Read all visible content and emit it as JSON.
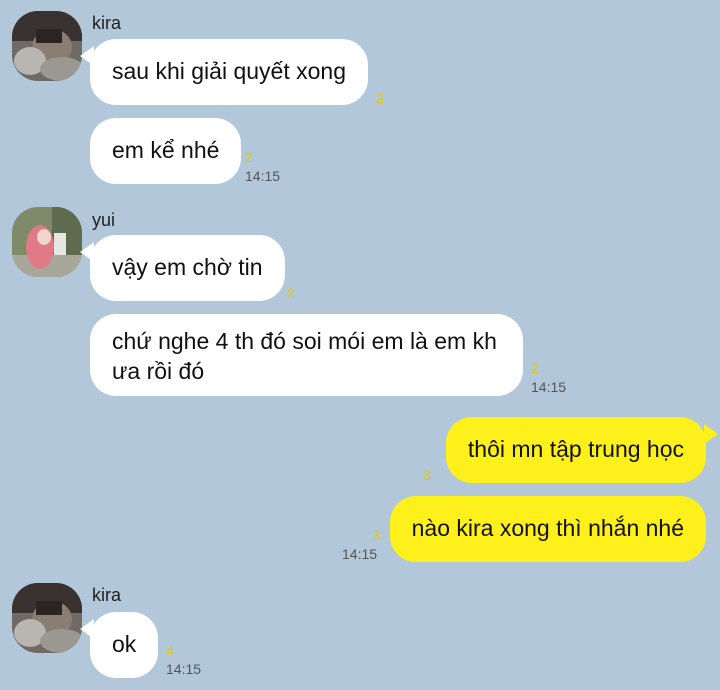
{
  "messages": [
    {
      "sender": "kira",
      "text": "sau khi giải quyết xong",
      "unread": "2"
    },
    {
      "sender": "kira",
      "text": "em kể nhé",
      "unread": "2",
      "time": "14:15"
    },
    {
      "sender": "yui",
      "text": "vậy em chờ tin",
      "unread": "2"
    },
    {
      "sender": "yui",
      "text_lines": [
        "chứ nghe 4 th đó soi mói em là em kh",
        "ưa rồi đó"
      ],
      "unread": "2",
      "time": "14:15"
    },
    {
      "sender": "me",
      "text": "thôi mn tập trung học",
      "unread": "3"
    },
    {
      "sender": "me",
      "text": "nào kira xong thì nhắn nhé",
      "unread": "3",
      "time": "14:15"
    },
    {
      "sender": "kira",
      "text": "ok",
      "unread": "4",
      "time": "14:15"
    }
  ],
  "senders": {
    "kira": "kira",
    "yui": "yui"
  },
  "colors": {
    "background": "#b2c7d9",
    "incoming_bubble": "#ffffff",
    "outgoing_bubble": "#fef01b",
    "unread": "#e5c800"
  },
  "icons": [
    "kira-avatar",
    "yui-avatar"
  ]
}
